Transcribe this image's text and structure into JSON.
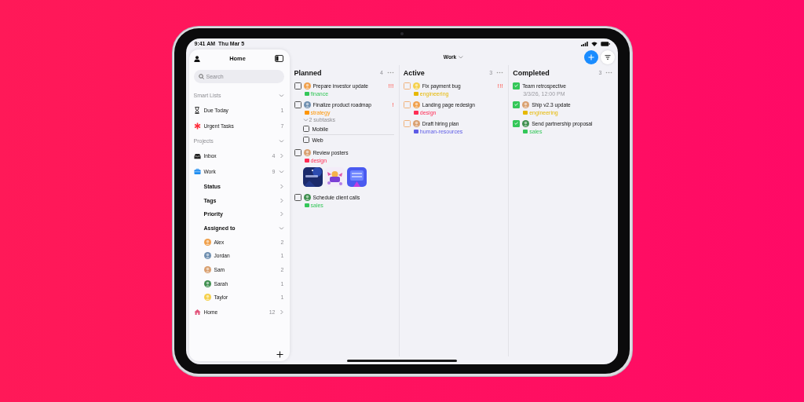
{
  "status_bar": {
    "time": "9:41 AM",
    "date": "Thu Mar 5"
  },
  "sidebar": {
    "title": "Home",
    "search": {
      "placeholder": "Search"
    },
    "sections": [
      {
        "title": "Smart Lists",
        "expanded": true,
        "items": [
          {
            "kind": "due",
            "label": "Due Today",
            "count": "1"
          },
          {
            "kind": "urgent",
            "label": "Urgent Tasks",
            "count": "7"
          }
        ]
      },
      {
        "title": "Projects",
        "expanded": true,
        "items": [
          {
            "kind": "inbox",
            "label": "Inbox",
            "count": "4",
            "expanded": false
          },
          {
            "kind": "work",
            "label": "Work",
            "count": "9",
            "expanded": true,
            "children": [
              {
                "kind": "filter",
                "label": "Status",
                "expanded": false
              },
              {
                "kind": "filter",
                "label": "Tags",
                "expanded": false
              },
              {
                "kind": "filter",
                "label": "Priority",
                "expanded": false
              },
              {
                "kind": "filter",
                "label": "Assigned to",
                "expanded": true,
                "children": [
                  {
                    "kind": "person",
                    "label": "Alex",
                    "count": "2",
                    "color": "#f0a04b"
                  },
                  {
                    "kind": "person",
                    "label": "Jordan",
                    "count": "1",
                    "color": "#6f8fb0"
                  },
                  {
                    "kind": "person",
                    "label": "Sam",
                    "count": "2",
                    "color": "#d9a070"
                  },
                  {
                    "kind": "person",
                    "label": "Sarah",
                    "count": "1",
                    "color": "#3f8f4f"
                  },
                  {
                    "kind": "person",
                    "label": "Taylor",
                    "count": "1",
                    "color": "#f5d04a"
                  }
                ]
              }
            ]
          },
          {
            "kind": "home",
            "label": "Home",
            "count": "12",
            "expanded": false
          }
        ]
      }
    ]
  },
  "toolbar": {
    "title": "Work"
  },
  "columns": [
    {
      "kind": "todo",
      "title": "Planned",
      "count": "4",
      "tasks": [
        {
          "title": "Prepare investor update",
          "checked": false,
          "avatar": {
            "color": "#f0a04b"
          },
          "tag": {
            "label": "finance",
            "color": "#34c759"
          },
          "priority": "!!!"
        },
        {
          "title": "Finalize product roadmap",
          "checked": false,
          "avatar": {
            "color": "#6f8fb0"
          },
          "tag": {
            "label": "strategy",
            "color": "#ff9500"
          },
          "priority": "!",
          "subtasks": {
            "label": "2 subtasks",
            "expanded": true,
            "items": [
              {
                "title": "Mobile",
                "checked": false
              },
              {
                "title": "Web",
                "checked": false
              }
            ]
          }
        },
        {
          "title": "Review posters",
          "checked": false,
          "avatar": {
            "color": "#d9a070"
          },
          "tag": {
            "label": "design",
            "color": "#ff2d55"
          }
        },
        {
          "title": "Schedule client calls",
          "checked": false,
          "avatar": {
            "color": "#3f8f4f"
          },
          "tag": {
            "label": "sales",
            "color": "#34c759"
          }
        }
      ]
    },
    {
      "kind": "in_progress",
      "title": "Active",
      "count": "3",
      "tasks": [
        {
          "title": "Fix payment bug",
          "checked": false,
          "avatar": {
            "color": "#f5d04a"
          },
          "tag": {
            "label": "engineering",
            "color": "#e6b800"
          },
          "priority": "!!!"
        },
        {
          "title": "Landing page redesign",
          "checked": false,
          "avatar": {
            "color": "#f0a04b"
          },
          "tag": {
            "label": "design",
            "color": "#ff2d55"
          }
        },
        {
          "title": "Draft hiring plan",
          "checked": false,
          "avatar": {
            "color": "#d9a070"
          },
          "tag": {
            "label": "human-resources",
            "color": "#5e5ce6"
          }
        }
      ]
    },
    {
      "kind": "done",
      "title": "Completed",
      "count": "3",
      "tasks": [
        {
          "title": "Team retrospective",
          "checked": true,
          "date": "3/3/26, 12:00 PM"
        },
        {
          "title": "Ship v2.3 update",
          "checked": true,
          "avatar": {
            "color": "#d9a070"
          },
          "tag": {
            "label": "engineering",
            "color": "#e6b800"
          }
        },
        {
          "title": "Send partnership proposal",
          "checked": true,
          "avatar": {
            "color": "#3f8f4f"
          },
          "tag": {
            "label": "sales",
            "color": "#34c759"
          }
        }
      ]
    }
  ]
}
